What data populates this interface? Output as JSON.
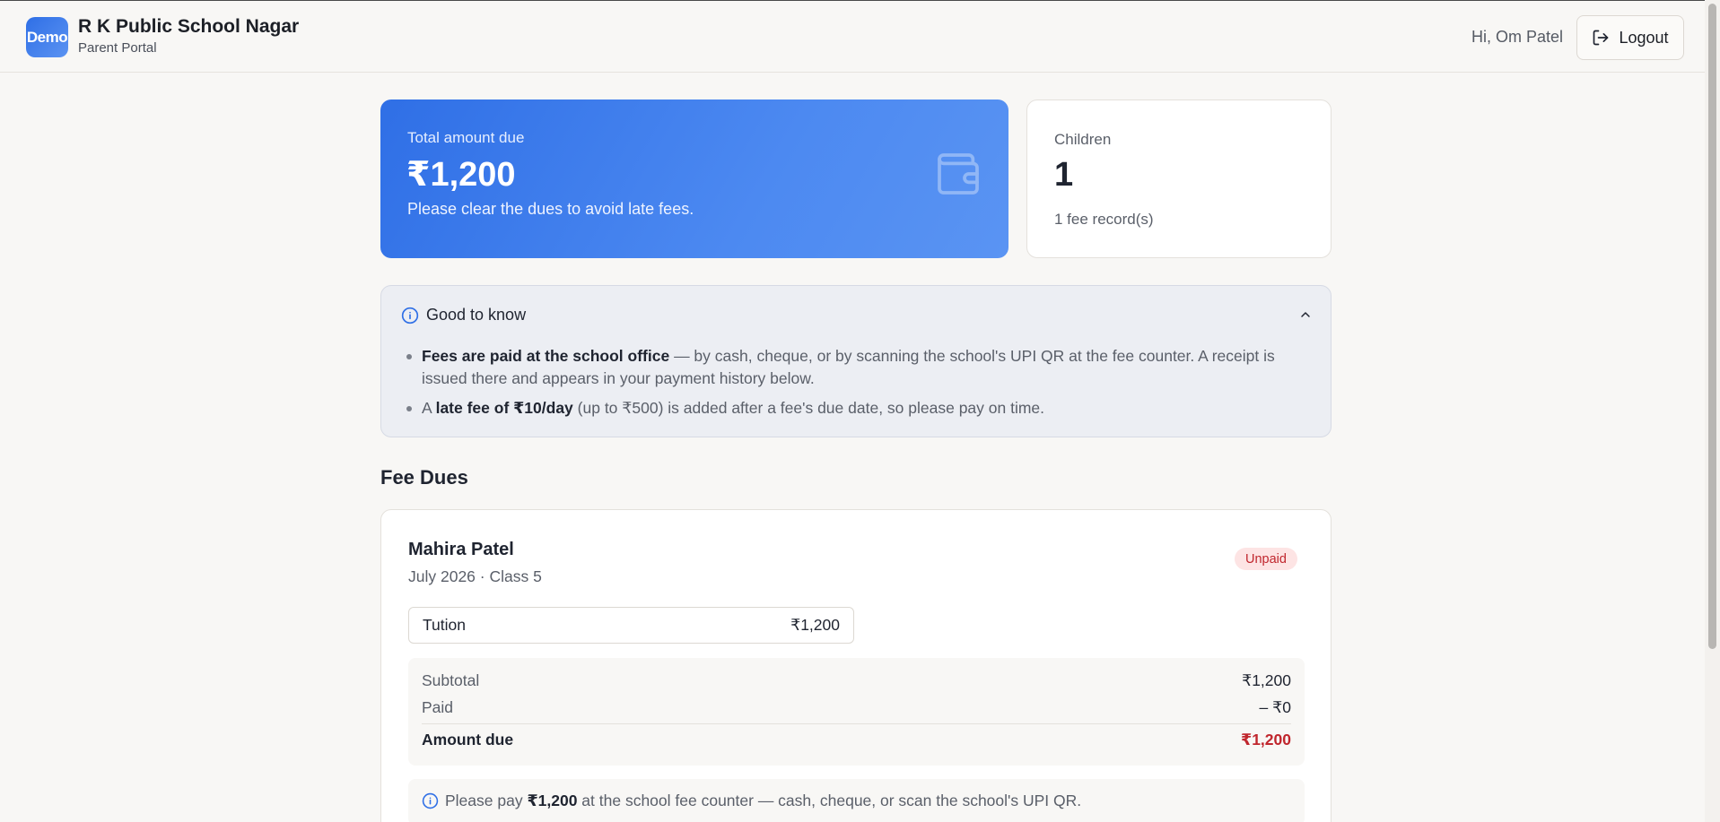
{
  "header": {
    "logo_text": "Demo",
    "school_name": "R K Public School Nagar",
    "subtitle": "Parent Portal",
    "greeting": "Hi, Om Patel",
    "logout_label": "Logout"
  },
  "summary": {
    "due_label": "Total amount due",
    "due_amount": "₹1,200",
    "due_note": "Please clear the dues to avoid late fees.",
    "children_label": "Children",
    "children_count": "1",
    "records_text": "1 fee record(s)"
  },
  "info": {
    "title": "Good to know",
    "item1_bold": "Fees are paid at the school office",
    "item1_rest": " — by cash, cheque, or by scanning the school's UPI QR at the fee counter. A receipt is issued there and appears in your payment history below.",
    "item2_prefix": "A ",
    "item2_bold": "late fee of ₹10/day",
    "item2_rest": " (up to ₹500) is added after a fee's due date, so please pay on time."
  },
  "fee_dues": {
    "section_title": "Fee Dues",
    "student_name": "Mahira Patel",
    "meta": "July 2026 · Class 5",
    "status": "Unpaid",
    "items": [
      {
        "label": "Tution",
        "amount": "₹1,200"
      }
    ],
    "subtotal_label": "Subtotal",
    "subtotal_value": "₹1,200",
    "paid_label": "Paid",
    "paid_value": "– ₹0",
    "amount_due_label": "Amount due",
    "amount_due_value": "₹1,200",
    "note_prefix": "Please pay ",
    "note_amount": "₹1,200",
    "note_rest": " at the school fee counter — cash, cheque, or scan the school's UPI QR."
  },
  "colors": {
    "accent": "#2f6fe6",
    "danger": "#c0262d",
    "badge_bg": "#fde4e4"
  },
  "icons": {
    "logout": "logout-icon",
    "wallet": "wallet-icon",
    "info": "info-icon",
    "collapse": "chevron-up-icon"
  }
}
